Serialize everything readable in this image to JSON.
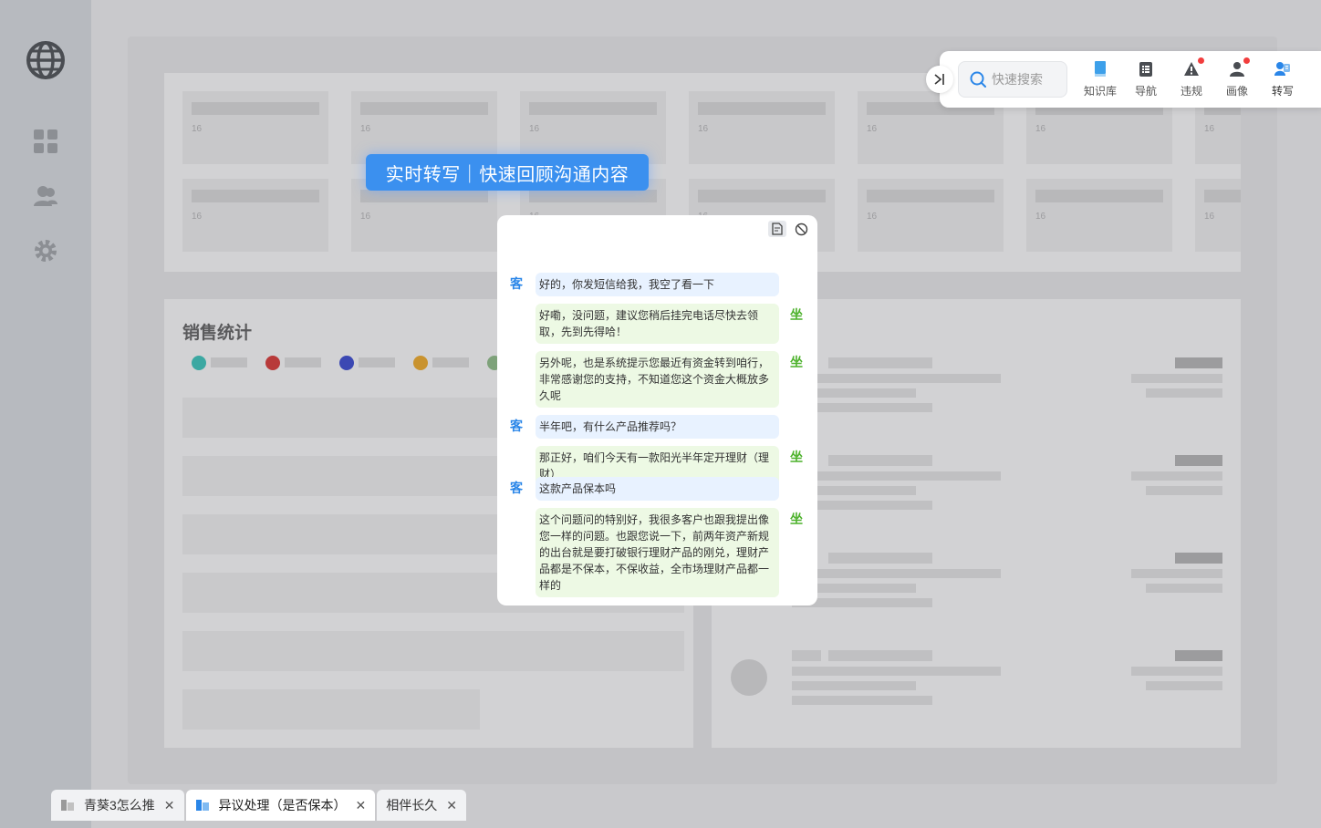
{
  "sidebar": {
    "items": [
      {
        "icon": "globe-icon"
      },
      {
        "icon": "dashboard-icon"
      },
      {
        "icon": "users-icon"
      },
      {
        "icon": "settings-icon"
      }
    ]
  },
  "background": {
    "card_numbers": [
      "16",
      "16",
      "16",
      "16",
      "16",
      "16",
      "16",
      "16",
      "16",
      "16",
      "16",
      "16",
      "16",
      "16"
    ],
    "sales_title": "销售统计"
  },
  "toolbar": {
    "search_placeholder": "快速搜索",
    "tools": [
      {
        "label": "知识库",
        "icon": "book-icon",
        "badge": false
      },
      {
        "label": "导航",
        "icon": "list-icon",
        "badge": false
      },
      {
        "label": "违规",
        "icon": "warning-icon",
        "badge": true
      },
      {
        "label": "画像",
        "icon": "profile-icon",
        "badge": true
      },
      {
        "label": "转写",
        "icon": "transcribe-icon",
        "badge": false
      }
    ]
  },
  "banner": {
    "text": "实时转写｜快速回顾沟通内容"
  },
  "chat": {
    "customer_tag": "客",
    "agent_tag": "坐",
    "messages": [
      {
        "role": "customer",
        "text": "好的，你发短信给我，我空了看一下"
      },
      {
        "role": "agent",
        "text": "好嘞，没问题，建议您稍后挂完电话尽快去领取，先到先得哈！"
      },
      {
        "role": "agent",
        "text": "另外呢，也是系统提示您最近有资金转到咱行，非常感谢您的支持，不知道您这个资金大概放多久呢"
      },
      {
        "role": "customer",
        "text": "半年吧，有什么产品推荐吗？"
      },
      {
        "role": "agent",
        "text": "那正好，咱们今天有一款阳光半年定开理财（理财）"
      },
      {
        "role": "customer",
        "text": "这款产品保本吗"
      },
      {
        "role": "agent",
        "text": "这个问题问的特别好，我很多客户也跟我提出像您一样的问题。也跟您说一下，前两年资产新规的出台就是要打破银行理财产品的刚兑，理财产品都是不保本，不保收益，全市场理财产品都一样的"
      }
    ]
  },
  "tabs": [
    {
      "label": "青葵3怎么推",
      "active": false
    },
    {
      "label": "异议处理（是否保本）",
      "active": true
    },
    {
      "label": "相伴长久",
      "active": false
    }
  ],
  "colors": {
    "accent": "#3b90ef",
    "customer_tag": "#2a86e8",
    "agent_tag": "#4db22c",
    "badge": "#f23d3d"
  }
}
